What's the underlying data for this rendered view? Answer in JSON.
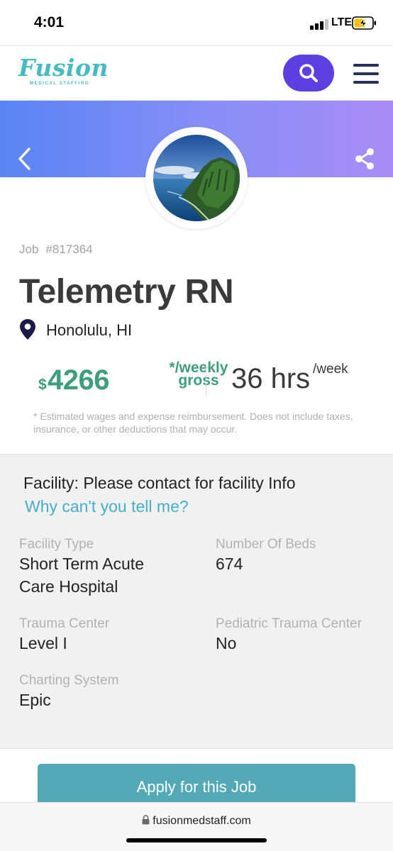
{
  "status_bar": {
    "time": "4:01",
    "network": "LTE",
    "signal_bars_active": 3,
    "signal_bars_total": 4,
    "battery_state": "charging"
  },
  "header": {
    "logo_text": "Fusion",
    "logo_subtext": "MEDICAL STAFFING",
    "search_icon": "search-icon",
    "menu_icon": "hamburger-menu-icon",
    "brand_color": "#45bcc0",
    "accent_color": "#5b3fe0"
  },
  "hero": {
    "back_icon": "chevron-left-icon",
    "share_icon": "share-icon",
    "image_alt": "island-coastline-photo"
  },
  "job": {
    "number_label": "Job",
    "number": "#817364",
    "title": "Telemetry RN",
    "location_icon": "location-pin-icon",
    "location": "Honolulu, HI"
  },
  "pay": {
    "currency": "$",
    "amount": "4266",
    "unit_line1": "*/weekly",
    "unit_line2": "gross",
    "hours_value": "36 hrs",
    "hours_unit": "/week",
    "disclaimer": "* Estimated wages and expense reimbursement. Does not include taxes, insurance, or other deductions that may occur.",
    "pay_color": "#3d9e7e"
  },
  "facility": {
    "heading": "Facility: Please contact for facility Info",
    "link": "Why can't you tell me?",
    "fields": [
      {
        "label": "Facility Type",
        "value": "Short Term Acute Care Hospital"
      },
      {
        "label": "Number Of Beds",
        "value": "674"
      },
      {
        "label": "Trauma Center",
        "value": "Level I"
      },
      {
        "label": "Pediatric Trauma Center",
        "value": "No"
      },
      {
        "label": "Charting System",
        "value": "Epic"
      }
    ]
  },
  "apply": {
    "label": "Apply for this Job"
  },
  "browser": {
    "url": "fusionmedstaff.com",
    "lock_icon": "lock-icon"
  }
}
